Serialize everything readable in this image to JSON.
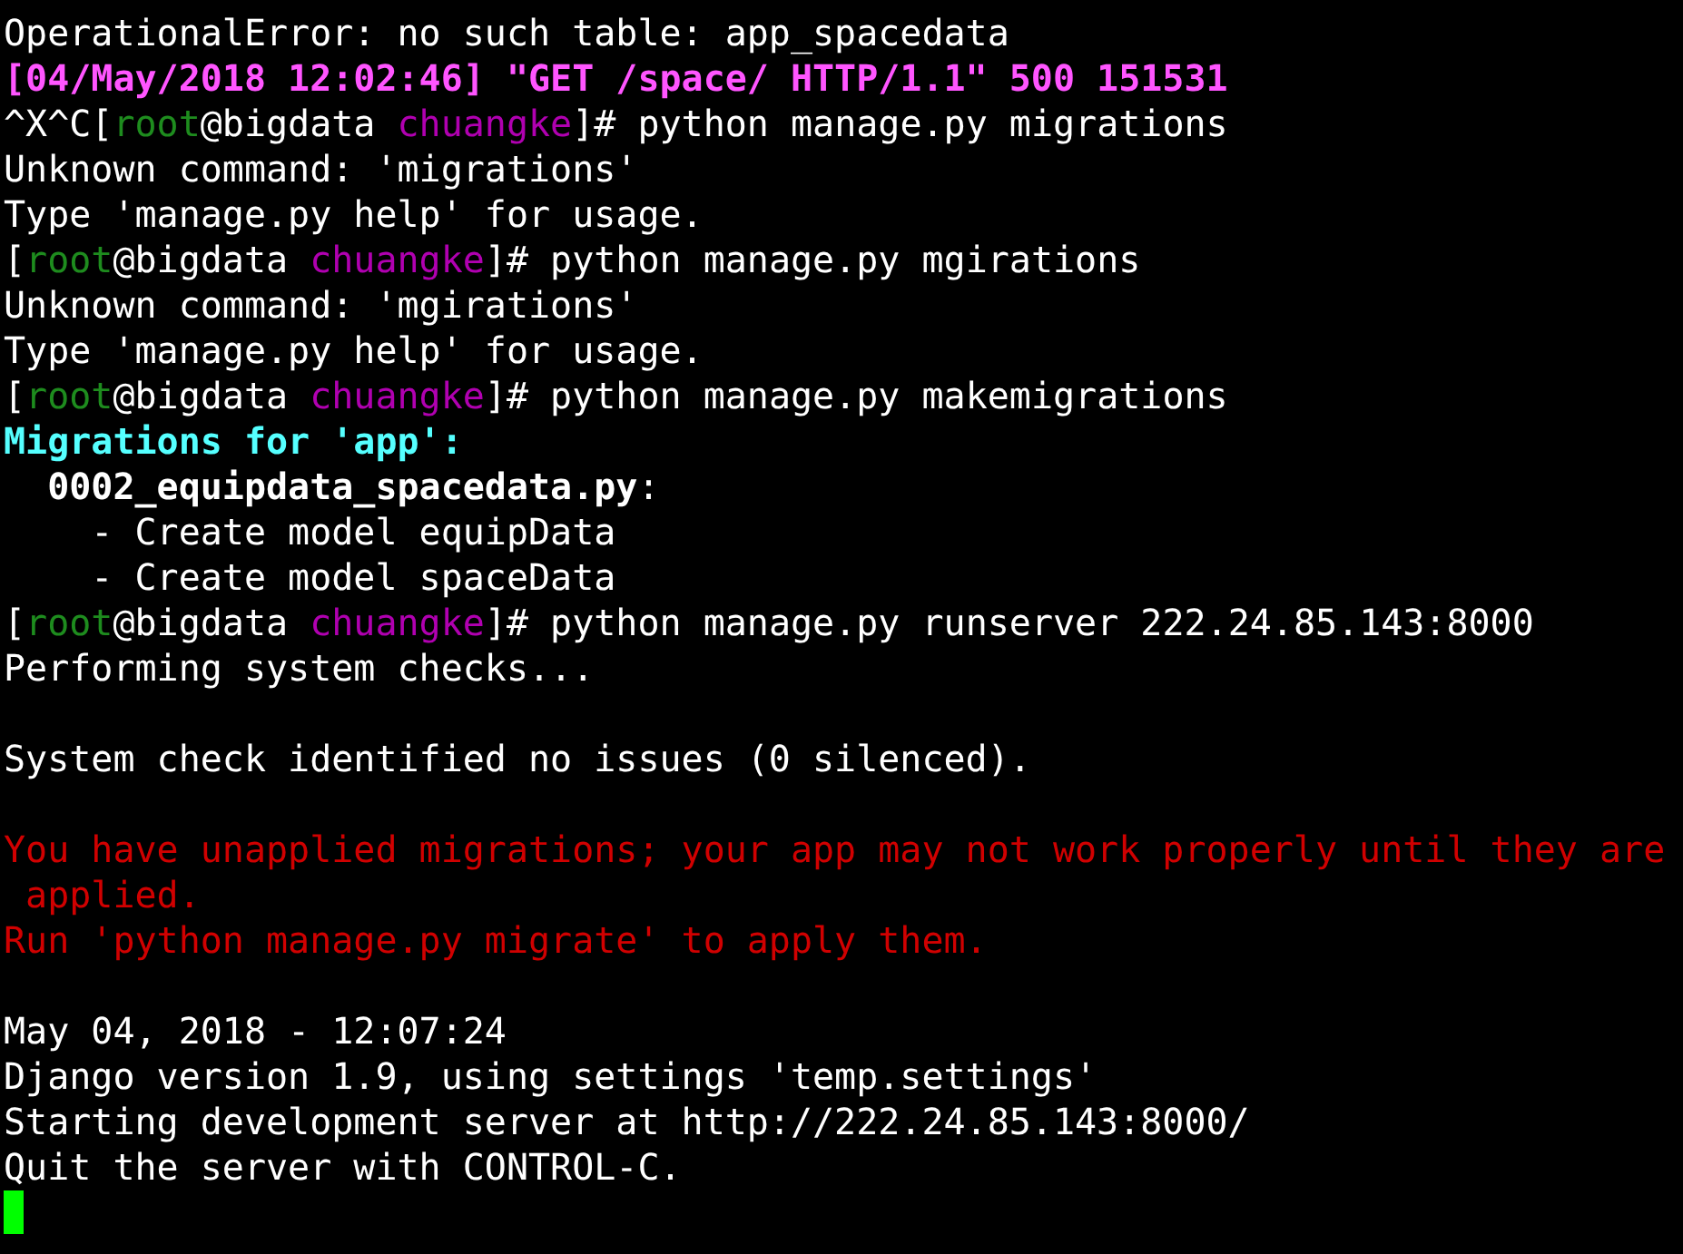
{
  "terminal": {
    "lines": [
      {
        "kind": "text",
        "segments": [
          {
            "text": "OperationalError: no such table: app_spacedata",
            "kind": "plain"
          }
        ]
      },
      {
        "kind": "text",
        "segments": [
          {
            "text": "[04/May/2018 12:02:46] \"GET /space/ HTTP/1.1\" 500 151531",
            "kind": "errorlog"
          }
        ]
      },
      {
        "kind": "text",
        "segments": [
          {
            "text": "^X^C[",
            "kind": "plain"
          },
          {
            "text": "root",
            "kind": "user"
          },
          {
            "text": "@bigdata ",
            "kind": "plain"
          },
          {
            "text": "chuangke",
            "kind": "directory"
          },
          {
            "text": "]# python manage.py migrations",
            "kind": "plain"
          }
        ]
      },
      {
        "kind": "text",
        "segments": [
          {
            "text": "Unknown command: 'migrations'",
            "kind": "plain"
          }
        ]
      },
      {
        "kind": "text",
        "segments": [
          {
            "text": "Type 'manage.py help' for usage.",
            "kind": "plain"
          }
        ]
      },
      {
        "kind": "text",
        "segments": [
          {
            "text": "[",
            "kind": "plain"
          },
          {
            "text": "root",
            "kind": "user"
          },
          {
            "text": "@bigdata ",
            "kind": "plain"
          },
          {
            "text": "chuangke",
            "kind": "directory"
          },
          {
            "text": "]# python manage.py mgirations",
            "kind": "plain"
          }
        ]
      },
      {
        "kind": "text",
        "segments": [
          {
            "text": "Unknown command: 'mgirations'",
            "kind": "plain"
          }
        ]
      },
      {
        "kind": "text",
        "segments": [
          {
            "text": "Type 'manage.py help' for usage.",
            "kind": "plain"
          }
        ]
      },
      {
        "kind": "text",
        "segments": [
          {
            "text": "[",
            "kind": "plain"
          },
          {
            "text": "root",
            "kind": "user"
          },
          {
            "text": "@bigdata ",
            "kind": "plain"
          },
          {
            "text": "chuangke",
            "kind": "directory"
          },
          {
            "text": "]# python manage.py makemigrations",
            "kind": "plain"
          }
        ]
      },
      {
        "kind": "text",
        "segments": [
          {
            "text": "Migrations for 'app':",
            "kind": "heading"
          }
        ]
      },
      {
        "kind": "text",
        "segments": [
          {
            "text": "  0002_equipdata_spacedata.py",
            "kind": "filename"
          },
          {
            "text": ":",
            "kind": "plain"
          }
        ]
      },
      {
        "kind": "text",
        "segments": [
          {
            "text": "    - Create model equipData",
            "kind": "plain"
          }
        ]
      },
      {
        "kind": "text",
        "segments": [
          {
            "text": "    - Create model spaceData",
            "kind": "plain"
          }
        ]
      },
      {
        "kind": "text",
        "segments": [
          {
            "text": "[",
            "kind": "plain"
          },
          {
            "text": "root",
            "kind": "user"
          },
          {
            "text": "@bigdata ",
            "kind": "plain"
          },
          {
            "text": "chuangke",
            "kind": "directory"
          },
          {
            "text": "]# python manage.py runserver 222.24.85.143:8000",
            "kind": "plain"
          }
        ]
      },
      {
        "kind": "text",
        "segments": [
          {
            "text": "Performing system checks...",
            "kind": "plain"
          }
        ]
      },
      {
        "kind": "blank"
      },
      {
        "kind": "text",
        "segments": [
          {
            "text": "System check identified no issues (0 silenced).",
            "kind": "plain"
          }
        ]
      },
      {
        "kind": "blank"
      },
      {
        "kind": "text",
        "segments": [
          {
            "text": "You have unapplied migrations; your app may not work properly until they are",
            "kind": "warning"
          }
        ]
      },
      {
        "kind": "text",
        "segments": [
          {
            "text": " applied.",
            "kind": "warning"
          }
        ]
      },
      {
        "kind": "text",
        "segments": [
          {
            "text": "Run 'python manage.py migrate' to apply them.",
            "kind": "warning"
          }
        ]
      },
      {
        "kind": "blank"
      },
      {
        "kind": "text",
        "segments": [
          {
            "text": "May 04, 2018 - 12:07:24",
            "kind": "plain"
          }
        ]
      },
      {
        "kind": "text",
        "segments": [
          {
            "text": "Django version 1.9, using settings 'temp.settings'",
            "kind": "plain"
          }
        ]
      },
      {
        "kind": "text",
        "segments": [
          {
            "text": "Starting development server at http://222.24.85.143:8000/",
            "kind": "plain"
          }
        ]
      },
      {
        "kind": "text",
        "segments": [
          {
            "text": "Quit the server with CONTROL-C.",
            "kind": "plain"
          }
        ]
      },
      {
        "kind": "cursor"
      }
    ]
  }
}
